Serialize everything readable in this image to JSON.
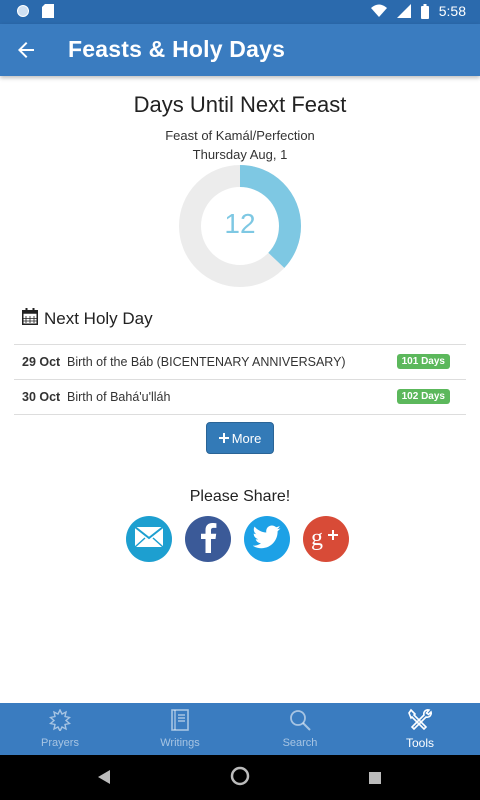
{
  "status_bar": {
    "time": "5:58"
  },
  "app_bar": {
    "title": "Feasts & Holy Days"
  },
  "countdown": {
    "heading": "Days Until Next Feast",
    "feast_name": "Feast of Kamál/Perfection",
    "feast_date": "Thursday Aug, 1",
    "days": "12",
    "progress_fraction": 0.37
  },
  "next_holy_day": {
    "heading": "Next Holy Day",
    "rows": [
      {
        "date": "29 Oct",
        "name": "Birth of the Báb (BICENTENARY ANNIVERSARY)",
        "badge": "101 Days"
      },
      {
        "date": "30 Oct",
        "name": "Birth of Bahá'u'lláh",
        "badge": "102 Days"
      }
    ],
    "more_label": "More"
  },
  "share": {
    "heading": "Please Share!"
  },
  "bottom_nav": [
    {
      "label": "Prayers",
      "icon": "prayers-star-icon"
    },
    {
      "label": "Writings",
      "icon": "book-icon"
    },
    {
      "label": "Search",
      "icon": "search-icon"
    },
    {
      "label": "Tools",
      "icon": "tools-icon",
      "active": true
    }
  ],
  "colors": {
    "primary": "#3a7cc0",
    "status_bar": "#2b6aad",
    "progress": "#7ec8e3",
    "badge": "#5cb85c",
    "button": "#337ab7"
  }
}
